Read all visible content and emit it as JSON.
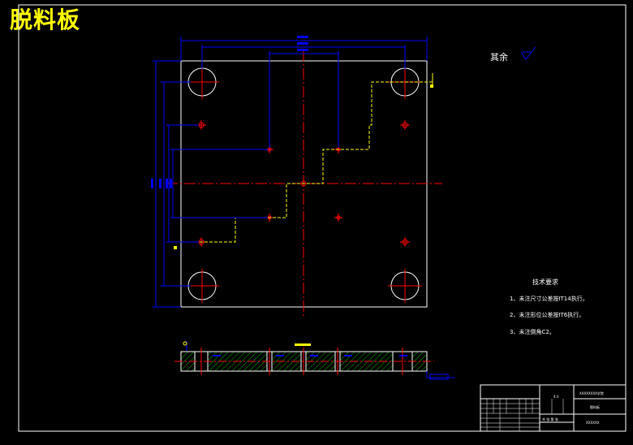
{
  "drawing": {
    "title": "脱料板",
    "roughness_note": "其余",
    "tech_requirements": {
      "heading": "技术要求",
      "items": [
        "1、未注尺寸公差按IT14执行。",
        "2、未注形位公差按IT6执行。",
        "3、未注倒角C2。"
      ]
    },
    "title_block": {
      "school": "XXXXXXXX学院",
      "part_name": "脱料板",
      "drawing_no": "XXXXXX",
      "scale": "4:3",
      "sheet_info": "共 张 第 张"
    }
  },
  "colors": {
    "background": "#000000",
    "outline": "#ffffff",
    "dimension": "#0000ff",
    "center_line": "#ff0000",
    "hidden_line": "#ffff00",
    "hatch": "#00b000",
    "title_text": "#ffff00"
  }
}
